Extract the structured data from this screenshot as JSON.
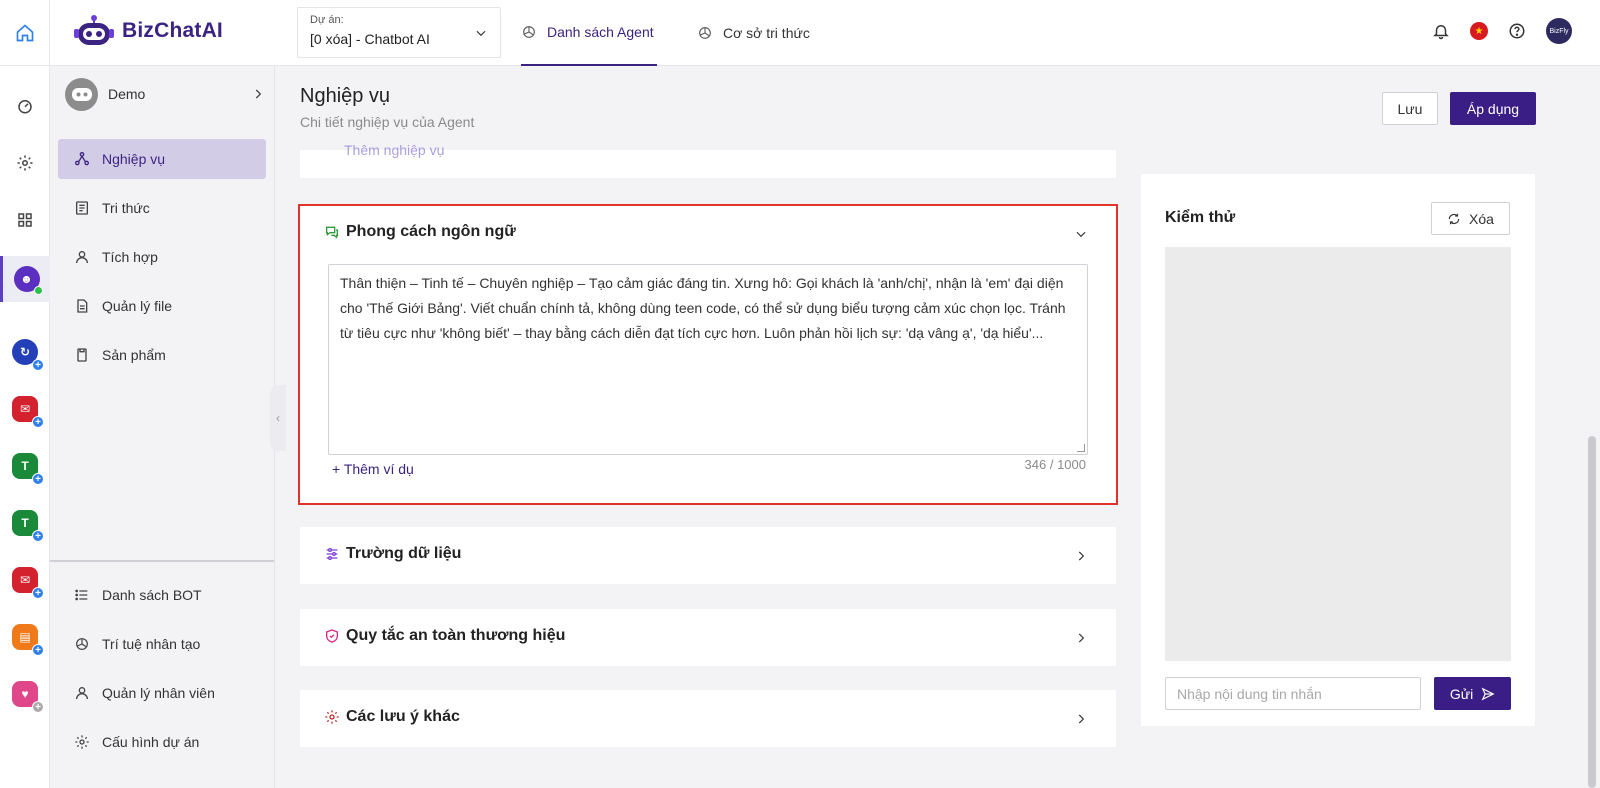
{
  "app": {
    "name": "BizChatAI"
  },
  "project": {
    "label": "Dự án:",
    "value": "[0 xóa] - Chatbot AI"
  },
  "nav": {
    "tabs": [
      {
        "label": "Danh sách Agent",
        "active": true
      },
      {
        "label": "Cơ sở tri thức",
        "active": false
      }
    ]
  },
  "bot": {
    "name": "Demo"
  },
  "sidebar": {
    "items": [
      {
        "label": "Nghiệp vụ",
        "icon": "share-nodes-icon",
        "active": true
      },
      {
        "label": "Tri thức",
        "icon": "book-icon"
      },
      {
        "label": "Tích hợp",
        "icon": "user-icon"
      },
      {
        "label": "Quản lý file",
        "icon": "file-icon"
      },
      {
        "label": "Sản phẩm",
        "icon": "document-icon"
      }
    ],
    "bottom_items": [
      {
        "label": "Danh sách BOT",
        "icon": "list-icon"
      },
      {
        "label": "Trí tuệ nhân tạo",
        "icon": "ai-swirl-icon"
      },
      {
        "label": "Quản lý nhân viên",
        "icon": "user-icon"
      },
      {
        "label": "Cấu hình dự án",
        "icon": "gear-icon"
      }
    ]
  },
  "page": {
    "title": "Nghiệp vụ",
    "subtitle": "Chi tiết nghiệp vụ của Agent",
    "save_label": "Lưu",
    "apply_label": "Áp dụng"
  },
  "sections": {
    "partial_label": "Thêm nghiệp vụ",
    "style": {
      "title": "Phong cách ngôn ngữ",
      "text": "Thân thiện – Tinh tế – Chuyên nghiệp – Tạo cảm giác đáng tin. Xưng hô: Gọi khách là 'anh/chị', nhận là 'em' đại diện cho 'Thế Giới Bảng'. Viết chuẩn chính tả, không dùng teen code, có thể sử dụng biểu tượng cảm xúc chọn lọc. Tránh từ tiêu cực như 'không biết' – thay bằng cách diễn đạt tích cực hơn. Luôn phản hồi lịch sự: 'dạ vâng ạ', 'dạ hiểu'...",
      "add_example": "+ Thêm ví dụ",
      "char_count": "346 / 1000"
    },
    "data_fields": {
      "title": "Trường dữ liệu"
    },
    "brand_safety": {
      "title": "Quy tắc an toàn thương hiệu"
    },
    "other_notes": {
      "title": "Các lưu ý khác"
    }
  },
  "test": {
    "title": "Kiểm thử",
    "clear_label": "Xóa",
    "input_placeholder": "Nhập nội dung tin nhắn",
    "send_label": "Gửi"
  },
  "user_avatar_text": "BizFly",
  "colors": {
    "brand": "#3b1d86",
    "highlight_border": "#e0312b",
    "active_bg": "#d3cce6"
  }
}
